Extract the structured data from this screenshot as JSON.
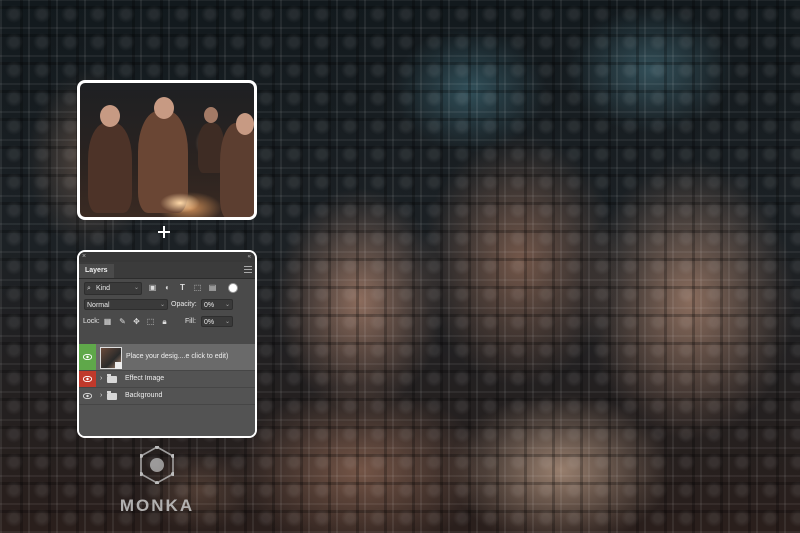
{
  "layers_panel": {
    "tab": "Layers",
    "filter": {
      "kind_label": "Kind",
      "filter_icons": [
        "image-filter-icon",
        "adjustment-filter-icon",
        "type-filter-icon",
        "shape-filter-icon",
        "smart-object-filter-icon"
      ]
    },
    "blend_mode": "Normal",
    "opacity_label": "Opacity:",
    "opacity_value": "0%",
    "lock_label": "Lock:",
    "fill_label": "Fill:",
    "fill_value": "0%",
    "layers": [
      {
        "name": "Place your desig....e click to edit)",
        "eye_color": "#5fa84a",
        "type": "smart-object",
        "selected": true
      },
      {
        "name": "Effect Image",
        "eye_color": "#c0392b",
        "type": "group"
      },
      {
        "name": "Background",
        "eye_color": "",
        "type": "group"
      }
    ]
  },
  "watermark": {
    "text": "MONKA"
  },
  "colors": {
    "panel_bg": "#4a4a4a",
    "selected_layer": "#6a6a6a",
    "eye_green": "#5fa84a",
    "eye_red": "#c0392b"
  }
}
